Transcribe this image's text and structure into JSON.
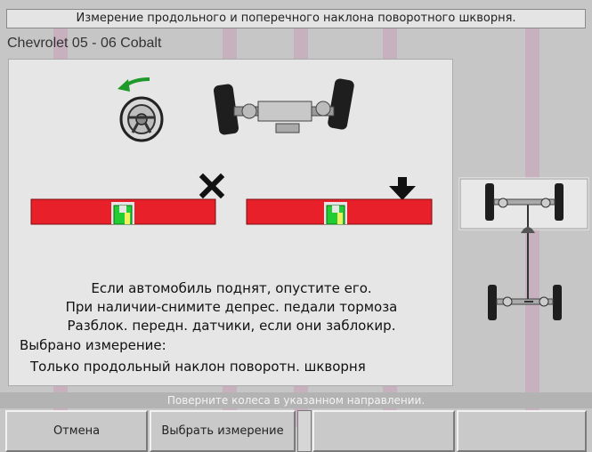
{
  "header": {
    "title": "Измерение продольного и поперечного наклона поворотного шкворня.",
    "vehicle": "Chevrolet 05 - 06 Cobalt"
  },
  "instructions": {
    "line1": "Если автомобиль поднят, опустите его.",
    "line2": "При наличии-снимите депрес. педали тормоза",
    "line3": "Разблок. передн. датчики, если они заблокир."
  },
  "selection": {
    "label": "Выбрано измерение:",
    "value": "Только продольный наклон поворотн. шкворня"
  },
  "status": {
    "text": "Поверните колеса в указанном направлении."
  },
  "softkeys": {
    "cancel": "Отмена",
    "select_measurement": "Выбрать измерение"
  },
  "icons": {
    "steering": "steering-wheel-icon",
    "turn_arrow": "turn-left-arrow-icon",
    "cross": "cross-icon",
    "down_arrow": "down-arrow-icon"
  },
  "colors": {
    "bar_red": "#e8202a",
    "indicator_green": "#22cc33",
    "turn_arrow_green": "#1f9a2a",
    "watermark": "#c2287a"
  }
}
